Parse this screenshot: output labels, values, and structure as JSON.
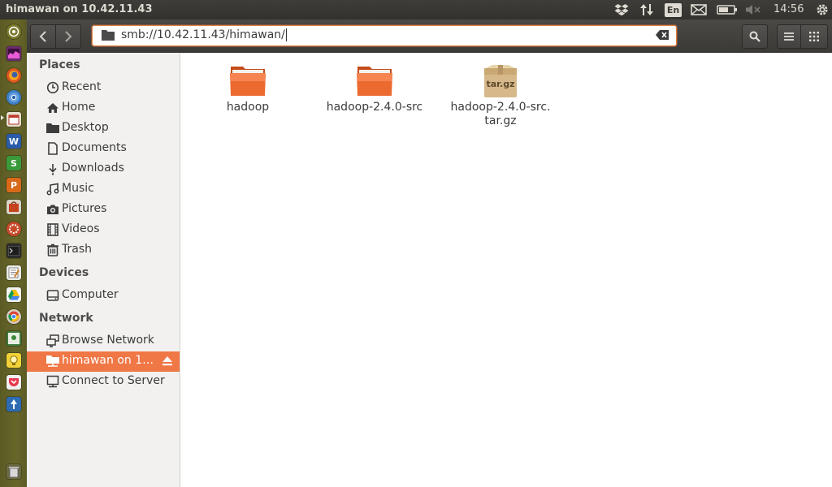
{
  "top_panel": {
    "window_title": "himawan on 10.42.11.43",
    "language": "En",
    "clock": "14:56"
  },
  "launcher": {
    "icons": [
      "dash-home-icon",
      "multiload-icon",
      "firefox-icon",
      "chromium-icon",
      "calendar-icon",
      "writer-icon",
      "calc-icon",
      "impress-icon",
      "software-center-icon",
      "settings-icon",
      "terminal-icon",
      "text-editor-icon",
      "drive-icon",
      "chrome-icon",
      "maps-icon",
      "lightbulb-icon",
      "pocket-icon",
      "transmission-icon",
      "trash-icon"
    ]
  },
  "header": {
    "location": "smb://10.42.11.43/himawan/"
  },
  "sidebar": {
    "places_heading": "Places",
    "places": [
      {
        "label": "Recent",
        "icon": "clock-icon"
      },
      {
        "label": "Home",
        "icon": "home-icon"
      },
      {
        "label": "Desktop",
        "icon": "folder-icon"
      },
      {
        "label": "Documents",
        "icon": "document-icon"
      },
      {
        "label": "Downloads",
        "icon": "download-icon"
      },
      {
        "label": "Music",
        "icon": "music-icon"
      },
      {
        "label": "Pictures",
        "icon": "camera-icon"
      },
      {
        "label": "Videos",
        "icon": "film-icon"
      },
      {
        "label": "Trash",
        "icon": "trash-icon"
      }
    ],
    "devices_heading": "Devices",
    "devices": [
      {
        "label": "Computer",
        "icon": "drive-icon"
      }
    ],
    "network_heading": "Network",
    "network": [
      {
        "label": "Browse Network",
        "icon": "network-icon"
      },
      {
        "label": "himawan on 1…",
        "icon": "network-share-icon",
        "active": true
      },
      {
        "label": "Connect to Server",
        "icon": "server-icon"
      }
    ]
  },
  "files": [
    {
      "name": "hadoop",
      "type": "folder"
    },
    {
      "name": "hadoop-2.4.0-src",
      "type": "folder"
    },
    {
      "name": "hadoop-2.4.0-src.",
      "name2": "tar.gz",
      "type": "archive",
      "badge": "tar.gz"
    }
  ],
  "colors": {
    "accent": "#f07746",
    "folder": "#e8642e",
    "panel": "#3b3a37"
  }
}
